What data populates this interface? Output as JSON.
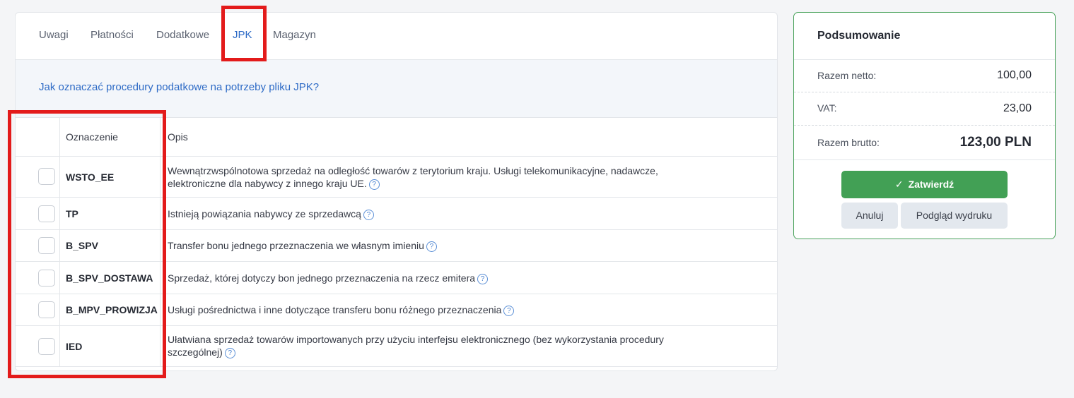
{
  "tabs": [
    {
      "label": "Uwagi"
    },
    {
      "label": "Płatności"
    },
    {
      "label": "Dodatkowe"
    },
    {
      "label": "JPK"
    },
    {
      "label": "Magazyn"
    }
  ],
  "active_tab": "JPK",
  "info_link": "Jak oznaczać procedury podatkowe na potrzeby pliku JPK?",
  "table": {
    "headers": {
      "code": "Oznaczenie",
      "description": "Opis"
    },
    "rows": [
      {
        "code": "WSTO_EE",
        "description": "Wewnątrzwspólnotowa sprzedaż na odległość towarów z terytorium kraju. Usługi telekomunikacyjne, nadawcze, elektroniczne dla nabywcy z innego kraju UE.",
        "checked": false
      },
      {
        "code": "TP",
        "description": "Istnieją powiązania nabywcy ze sprzedawcą",
        "checked": false
      },
      {
        "code": "B_SPV",
        "description": "Transfer bonu jednego przeznaczenia we własnym imieniu",
        "checked": false
      },
      {
        "code": "B_SPV_DOSTAWA",
        "description": "Sprzedaż, której dotyczy bon jednego przeznaczenia na rzecz emitera",
        "checked": false
      },
      {
        "code": "B_MPV_PROWIZJA",
        "description": "Usługi pośrednictwa i inne dotyczące transferu bonu różnego przeznaczenia",
        "checked": false
      },
      {
        "code": "IED",
        "description": "Ułatwiana sprzedaż towarów importowanych przy użyciu interfejsu elektronicznego (bez wykorzystania procedury szczególnej)",
        "checked": false
      }
    ],
    "help_icon": "question-circle-icon"
  },
  "summary": {
    "title": "Podsumowanie",
    "net_label": "Razem netto:",
    "net_value": "100,00",
    "vat_label": "VAT:",
    "vat_value": "23,00",
    "gross_label": "Razem brutto:",
    "gross_value": "123,00 PLN",
    "confirm_label": "Zatwierdź",
    "cancel_label": "Anuluj",
    "preview_label": "Podgląd wydruku"
  },
  "colors": {
    "accent": "#2e6bc6",
    "confirm": "#42a055",
    "highlight": "#e31b1b"
  }
}
